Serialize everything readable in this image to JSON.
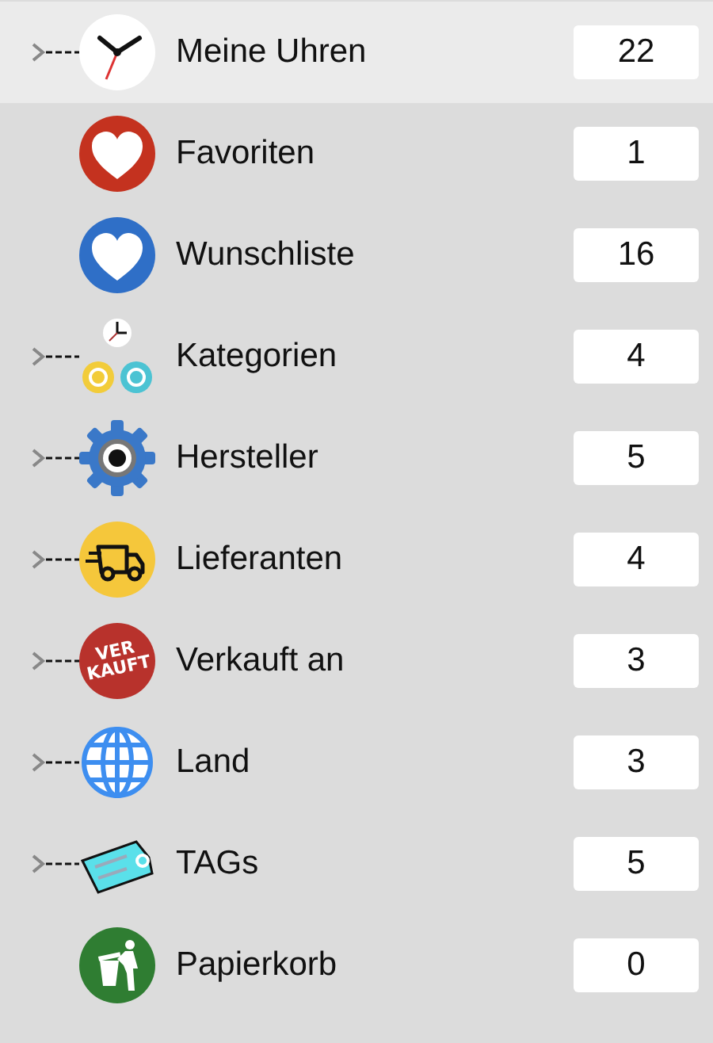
{
  "items": [
    {
      "label": "Meine Uhren",
      "count": "22",
      "kind": "clock",
      "expandable": true,
      "selected": true
    },
    {
      "label": "Favoriten",
      "count": "1",
      "kind": "heart-red",
      "expandable": false,
      "selected": false
    },
    {
      "label": "Wunschliste",
      "count": "16",
      "kind": "heart-blue",
      "expandable": false,
      "selected": false
    },
    {
      "label": "Kategorien",
      "count": "4",
      "kind": "clock-gears",
      "expandable": true,
      "selected": false
    },
    {
      "label": "Hersteller",
      "count": "5",
      "kind": "gear",
      "expandable": true,
      "selected": false
    },
    {
      "label": "Lieferanten",
      "count": "4",
      "kind": "truck",
      "expandable": true,
      "selected": false
    },
    {
      "label": "Verkauft an",
      "count": "3",
      "kind": "stamp",
      "icon_text": [
        "VER",
        "KAUFT"
      ],
      "expandable": true,
      "selected": false
    },
    {
      "label": "Land",
      "count": "3",
      "kind": "globe",
      "expandable": true,
      "selected": false
    },
    {
      "label": "TAGs",
      "count": "5",
      "kind": "tag",
      "expandable": true,
      "selected": false
    },
    {
      "label": "Papierkorb",
      "count": "0",
      "kind": "trash",
      "expandable": false,
      "selected": false
    }
  ]
}
